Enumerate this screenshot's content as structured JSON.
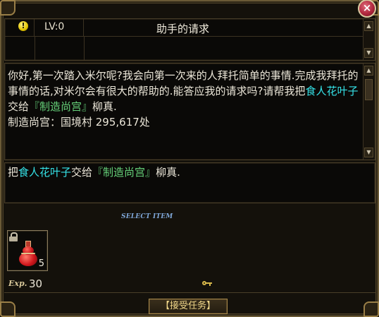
{
  "window": {
    "close_glyph": "×"
  },
  "header": {
    "warning_glyph": "!",
    "level": "LV:0",
    "title": "助手的请求"
  },
  "description": {
    "parts": [
      {
        "text": "你好,第一次踏入米尔呢?我会向第一次来的人拜托简单的事情.完成我拜托的事情的话,对米尔会有很大的帮助的.能答应我的请求吗?请帮我把",
        "color": "normal"
      },
      {
        "text": "食人花叶子",
        "color": "cyan"
      },
      {
        "text": "交给",
        "color": "normal"
      },
      {
        "text": "『制造尚宫』",
        "color": "green"
      },
      {
        "text": "柳真.",
        "color": "normal"
      }
    ],
    "location_line": "制造尚宫：国境村 295,617处"
  },
  "task": {
    "prefix": "把",
    "item": "食人花叶子",
    "middle": "交给",
    "npc": "『制造尚宫』",
    "suffix": "柳真."
  },
  "reward": {
    "select_label": "SELECT ITEM",
    "item_name_icon": "red-potion-icon",
    "item_count": "5",
    "exp_label": "Exp.",
    "exp_value": "30"
  },
  "footer": {
    "accept_label": "【接受任务】"
  },
  "colors": {
    "highlight_cyan": "#35e3e8",
    "highlight_green": "#66d27a",
    "frame_gold": "#a8894a"
  }
}
